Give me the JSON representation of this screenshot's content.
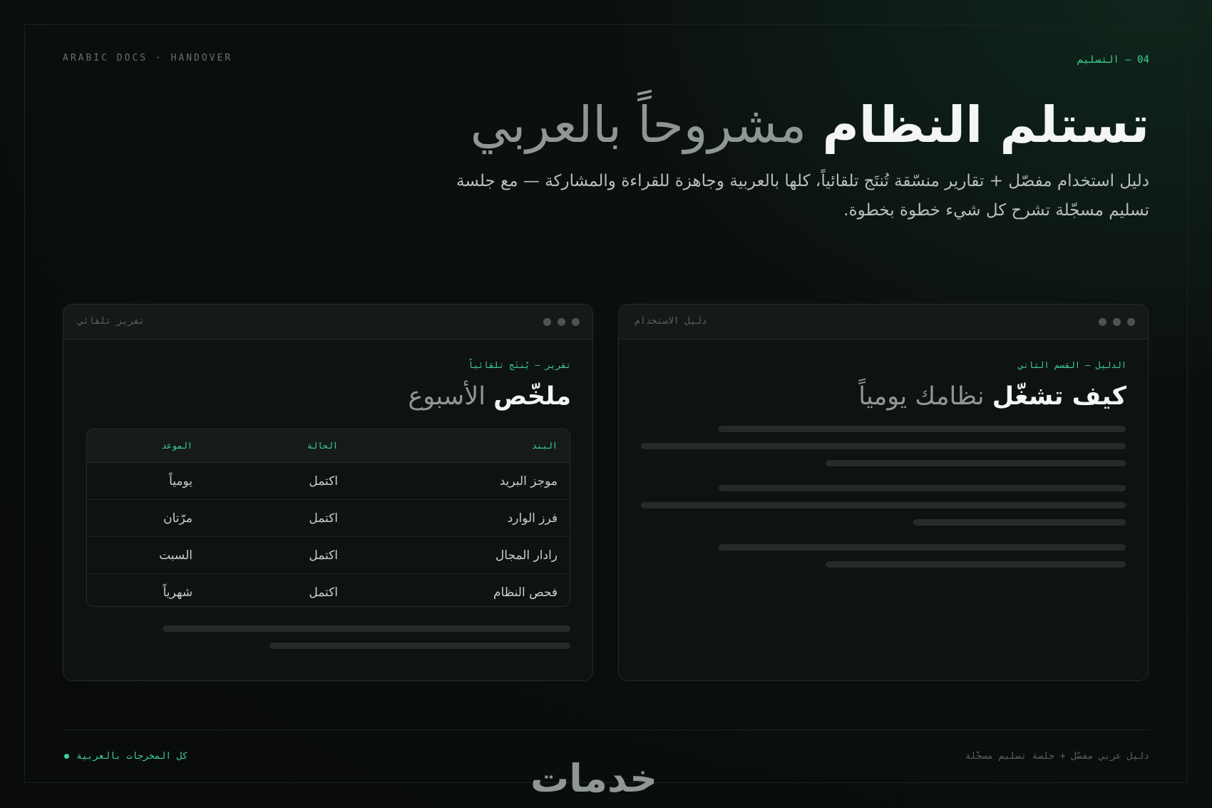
{
  "header": {
    "tag_left": "ARABIC DOCS · HANDOVER",
    "tag_right": "04 — التسليم"
  },
  "hero": {
    "title_bold": "تستلم النظام",
    "title_light": "مشروحاً بالعربي",
    "subtitle": "دليل استخدام مفصّل + تقارير منسّقة تُنتَج تلقائياً، كلها بالعربية وجاهزة للقراءة والمشاركة — مع جلسة تسليم مسجّلة تشرح كل شيء خطوة بخطوة."
  },
  "report_card": {
    "bar_title": "تقرير تلقائي",
    "eyebrow": "تقرير — يُنتَج تلقائياً",
    "title_bold": "ملخّص",
    "title_light": "الأسبوع",
    "table": {
      "headers": [
        "البند",
        "الحالة",
        "الموعد"
      ],
      "rows": [
        [
          "موجز البريد",
          "اكتمل",
          "يومياً"
        ],
        [
          "فرز الوارد",
          "اكتمل",
          "مرّتان"
        ],
        [
          "رادار المجال",
          "اكتمل",
          "السبت"
        ],
        [
          "فحص النظام",
          "اكتمل",
          "شهرياً"
        ]
      ]
    }
  },
  "guide_card": {
    "bar_title": "دليل الاستخدام",
    "eyebrow": "الدليل — القسم الثاني",
    "title_bold": "كيف تشغّل",
    "title_light": "نظامك يومياً"
  },
  "footer": {
    "left": "كل المخرجات بالعربية",
    "right": "دليل عربي مفصّل + جلسة تسليم مسجّلة",
    "logo": "خدمات"
  },
  "colors": {
    "accent": "#3fd39a",
    "background": "#0a0c0c",
    "card": "#0e1211"
  }
}
